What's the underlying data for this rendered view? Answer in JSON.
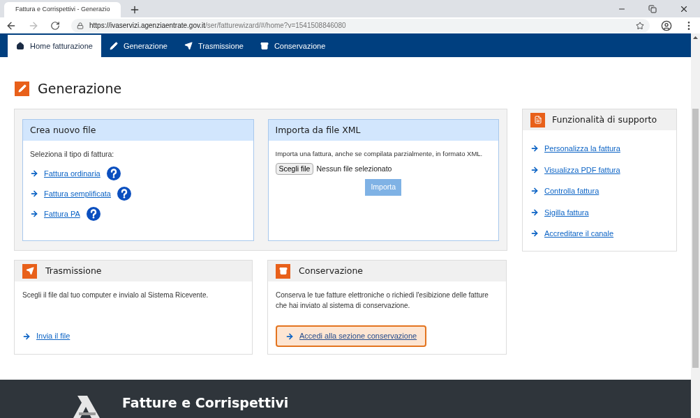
{
  "browser": {
    "tab_title": "Fattura e Corrispettivi - Generazio",
    "url_host": "https://ivaservizi.agenziaentrate.gov.it",
    "url_path": "/ser/fatturewizard/#/home?v=1541508846080"
  },
  "nav": [
    {
      "label": "Home fatturazione",
      "kind": "home",
      "selected": true
    },
    {
      "label": "Generazione",
      "kind": "pencil",
      "selected": false
    },
    {
      "label": "Trasmissione",
      "kind": "send",
      "selected": false
    },
    {
      "label": "Conservazione",
      "kind": "archive",
      "selected": false
    }
  ],
  "page_title": "Generazione",
  "crea": {
    "title": "Crea nuovo file",
    "intro": "Seleziona il tipo di fattura:",
    "links": [
      {
        "label": "Fattura ordinaria"
      },
      {
        "label": "Fattura semplificata"
      },
      {
        "label": "Fattura PA"
      }
    ]
  },
  "importa": {
    "title": "Importa da file XML",
    "intro": "Importa una fattura, anche se compilata parzialmente, in formato XML.",
    "file_button": "Scegli file",
    "file_status": "Nessun file selezionato",
    "submit": {
      "label": "Importa",
      "disabled": true
    }
  },
  "support": {
    "title": "Funzionalità di supporto",
    "links": [
      {
        "label": "Personalizza la fattura"
      },
      {
        "label": "Visualizza PDF fattura"
      },
      {
        "label": "Controlla fattura"
      },
      {
        "label": "Sigilla fattura"
      },
      {
        "label": "Accreditare il canale"
      }
    ]
  },
  "trasmissione": {
    "title": "Trasmissione",
    "text": "Scegli il file dal tuo computer e invialo al Sistema Ricevente.",
    "link": {
      "label": "Invia il file",
      "highlighted": false
    }
  },
  "conservazione": {
    "title": "Conservazione",
    "text": "Conserva le tue fatture elettroniche o richiedi l'esibizione delle fatture che hai inviato al sistema di conservazione.",
    "link": {
      "label": "Accedi alla sezione conservazione",
      "highlighted": true
    }
  },
  "footer": {
    "title": "Fatture e Corrispettivi"
  }
}
